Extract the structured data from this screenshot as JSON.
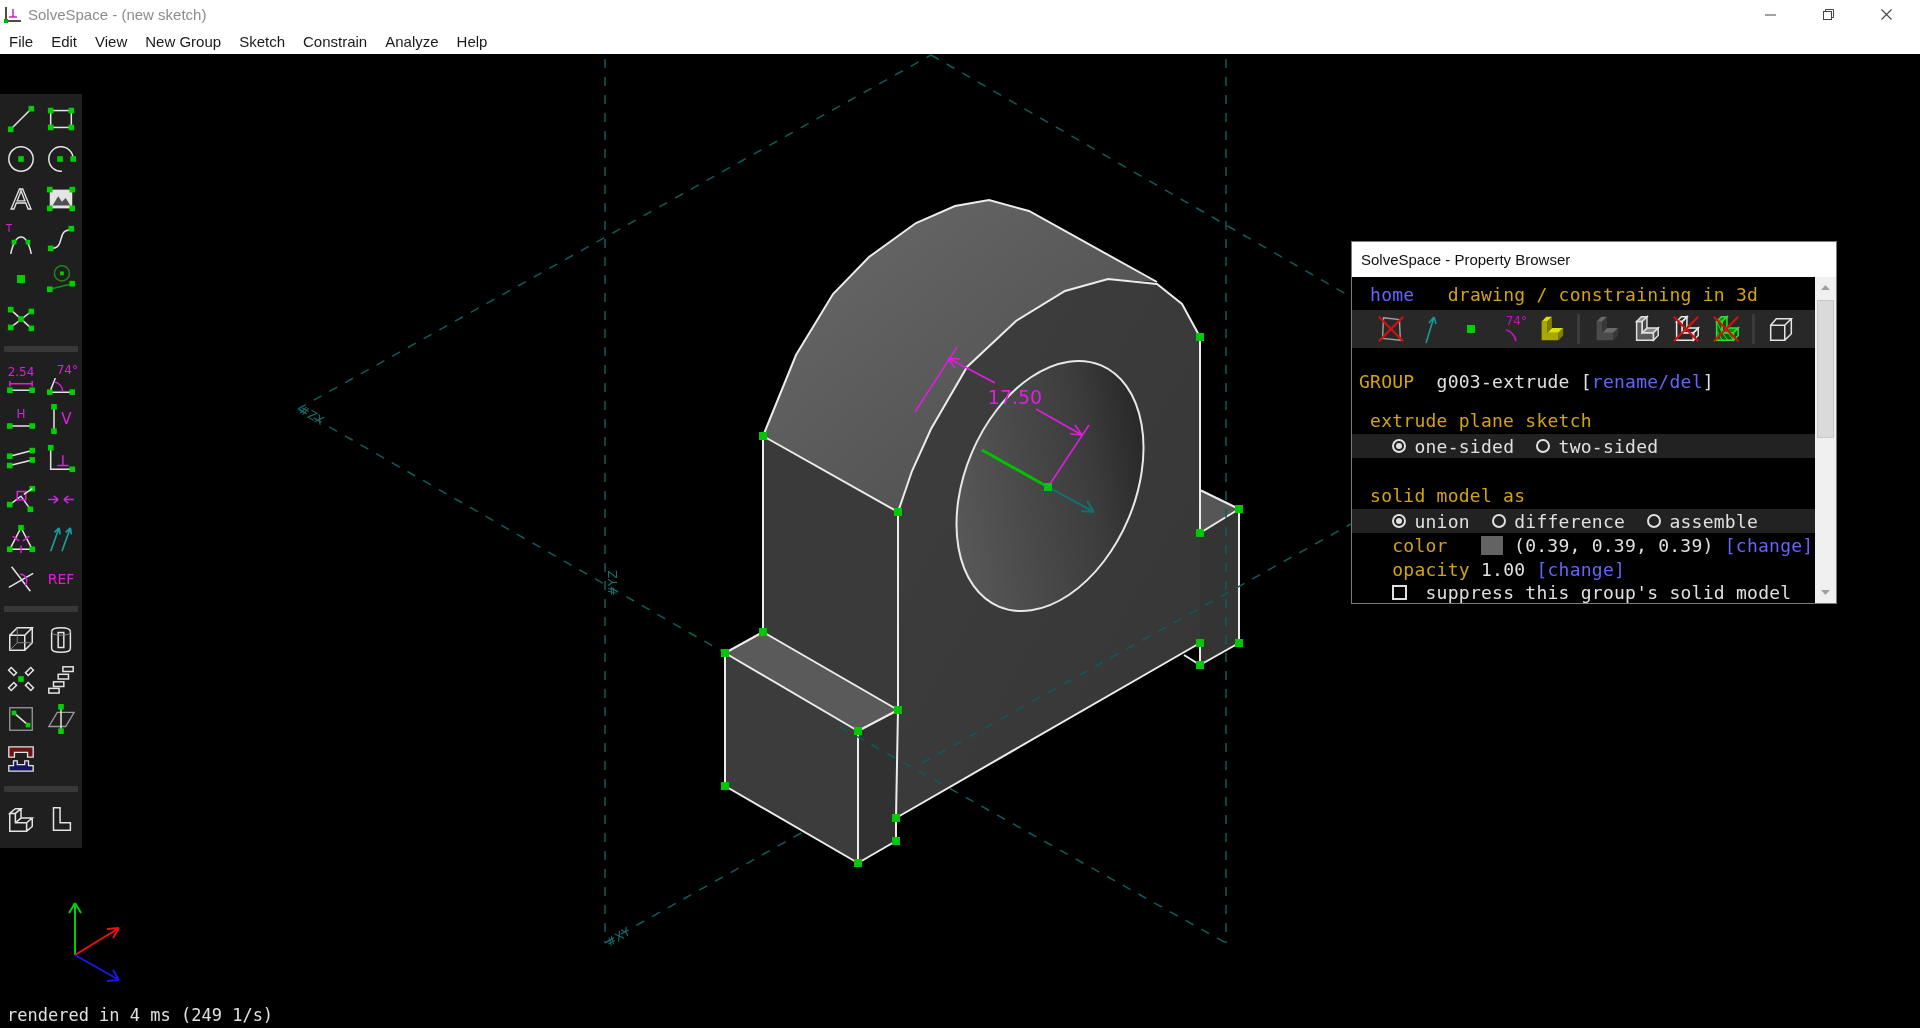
{
  "window": {
    "title": "SolveSpace - (new sketch)"
  },
  "menu": [
    {
      "label": "File"
    },
    {
      "label": "Edit"
    },
    {
      "label": "View"
    },
    {
      "label": "New Group"
    },
    {
      "label": "Sketch"
    },
    {
      "label": "Constrain"
    },
    {
      "label": "Analyze"
    },
    {
      "label": "Help"
    }
  ],
  "toolbar": [
    [
      {
        "kind": "line"
      },
      {
        "kind": "rectangle"
      },
      {
        "kind": "circle"
      },
      {
        "kind": "arc"
      },
      {
        "kind": "text",
        "label": "A"
      },
      {
        "kind": "image"
      },
      {
        "kind": "tangent-arc",
        "label": "T"
      },
      {
        "kind": "bezier"
      },
      {
        "kind": "point"
      },
      {
        "kind": "workplane"
      },
      {
        "kind": "split"
      }
    ],
    [
      {
        "kind": "distance",
        "label": "2.54"
      },
      {
        "kind": "angle",
        "label": "74°"
      },
      {
        "kind": "horizontal",
        "label": "H"
      },
      {
        "kind": "vertical",
        "label": "V"
      },
      {
        "kind": "parallel"
      },
      {
        "kind": "perpendicular"
      },
      {
        "kind": "point-on"
      },
      {
        "kind": "symmetric"
      },
      {
        "kind": "equal"
      },
      {
        "kind": "orientation"
      },
      {
        "kind": "other"
      },
      {
        "kind": "reference",
        "label": "REF"
      }
    ],
    [
      {
        "kind": "extrude"
      },
      {
        "kind": "lathe"
      },
      {
        "kind": "step-rotate"
      },
      {
        "kind": "step-translate"
      },
      {
        "kind": "sketch-workplane"
      },
      {
        "kind": "sketch-3d"
      },
      {
        "kind": "link"
      }
    ],
    [
      {
        "kind": "iso-view"
      },
      {
        "kind": "ortho-view"
      }
    ]
  ],
  "canvas": {
    "planes": [
      {
        "label": "#ZX"
      },
      {
        "label": "#YZ"
      },
      {
        "label": "#XY"
      }
    ],
    "dimension": "17.50",
    "status": "rendered in 4 ms (249 1/s)"
  },
  "property_browser": {
    "title": "SolveSpace - Property Browser",
    "nav": {
      "link": "home",
      "heading": "drawing / constraining in 3d"
    },
    "toggle_groups": [
      [
        {
          "kind": "workplanes",
          "on": false
        },
        {
          "kind": "normals",
          "on": true
        },
        {
          "kind": "points",
          "on": true
        },
        {
          "kind": "constraints",
          "label": "74°",
          "on": true
        },
        {
          "kind": "faces",
          "on": true
        }
      ],
      [
        {
          "kind": "shaded",
          "on": true
        },
        {
          "kind": "edges",
          "on": true
        },
        {
          "kind": "outlines",
          "on": false
        },
        {
          "kind": "mesh",
          "on": false
        }
      ],
      [
        {
          "kind": "hidden-lines",
          "on": true
        }
      ]
    ],
    "group": {
      "label": "GROUP",
      "name": "g003-extrude",
      "open": "[",
      "links": [
        {
          "text": "rename"
        },
        {
          "text": "del"
        }
      ],
      "divider": "/",
      "close": "]"
    },
    "sections": [
      {
        "title": "extrude plane sketch",
        "options": [
          {
            "label": "one-sided",
            "selected": true
          },
          {
            "label": "two-sided",
            "selected": false
          }
        ]
      },
      {
        "title": "solid model as",
        "options": [
          {
            "label": "union",
            "selected": true
          },
          {
            "label": "difference",
            "selected": false
          },
          {
            "label": "assemble",
            "selected": false
          }
        ]
      }
    ],
    "color": {
      "label": "color",
      "value": "(0.39, 0.39, 0.39)",
      "link": "[change]"
    },
    "opacity": {
      "label": "opacity",
      "value": "1.00",
      "link": "[change]"
    },
    "suppress": {
      "label": "suppress this group's solid model",
      "checked": false
    }
  }
}
